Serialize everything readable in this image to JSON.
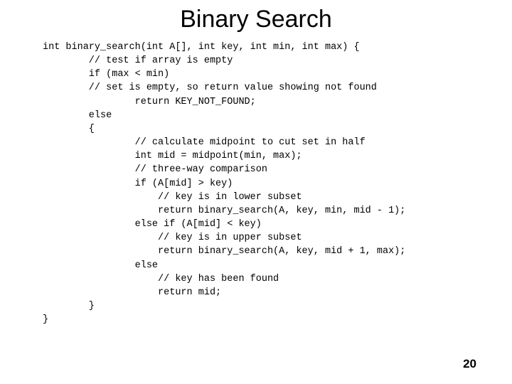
{
  "title": "Binary Search",
  "code": "int binary_search(int A[], int key, int min, int max) {\n        // test if array is empty\n        if (max < min)\n        // set is empty, so return value showing not found\n                return KEY_NOT_FOUND;\n        else\n        {\n                // calculate midpoint to cut set in half\n                int mid = midpoint(min, max);\n                // three-way comparison\n                if (A[mid] > key)\n                    // key is in lower subset\n                    return binary_search(A, key, min, mid - 1);\n                else if (A[mid] < key)\n                    // key is in upper subset\n                    return binary_search(A, key, mid + 1, max);\n                else\n                    // key has been found\n                    return mid;\n        }\n}",
  "page_number": "20"
}
